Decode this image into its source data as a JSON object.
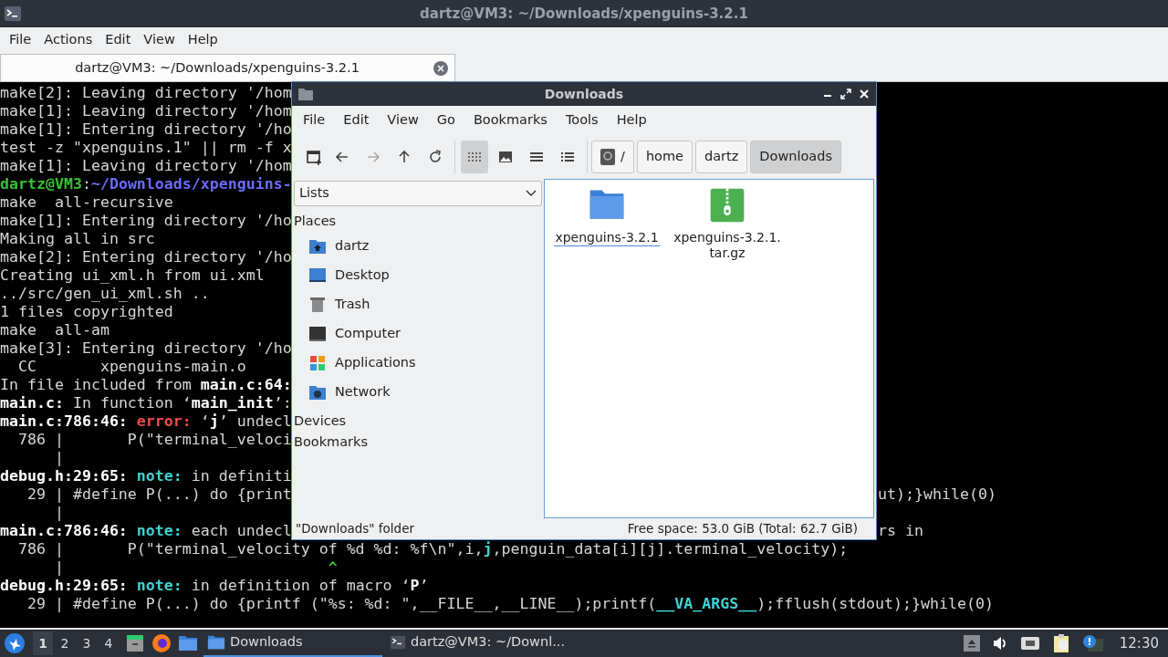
{
  "terminal_window": {
    "title": "dartz@VM3: ~/Downloads/xpenguins-3.2.1",
    "menu": [
      "File",
      "Actions",
      "Edit",
      "View",
      "Help"
    ],
    "tabs": [
      {
        "label": "dartz@VM3: ~/Downloads/xpenguins-3.2.1",
        "selected": true
      }
    ],
    "lines": [
      {
        "left": [
          {
            "t": "make[2]: Leaving directory '/hom"
          }
        ]
      },
      {
        "left": [
          {
            "t": "make[1]: Leaving directory '/hom"
          }
        ]
      },
      {
        "left": [
          {
            "t": "make[1]: Entering directory '/ho"
          }
        ]
      },
      {
        "left": [
          {
            "t": "test -z \"xpenguins.1\" || rm -f x"
          }
        ]
      },
      {
        "left": [
          {
            "t": "make[1]: Leaving directory '/hom"
          }
        ]
      },
      {
        "left": [
          {
            "t": "dartz@VM3",
            "kind": "user"
          },
          {
            "t": ":"
          },
          {
            "t": "~/Downloads/xpenguins-",
            "kind": "path"
          }
        ]
      },
      {
        "left": [
          {
            "t": "make  all-recursive"
          }
        ]
      },
      {
        "left": [
          {
            "t": "make[1]: Entering directory '/ho"
          }
        ]
      },
      {
        "left": [
          {
            "t": "Making all in src"
          }
        ]
      },
      {
        "left": [
          {
            "t": "make[2]: Entering directory '/ho"
          }
        ]
      },
      {
        "left": [
          {
            "t": "Creating ui_xml.h from ui.xml"
          }
        ]
      },
      {
        "left": [
          {
            "t": "../src/gen_ui_xml.sh .."
          }
        ]
      },
      {
        "left": [
          {
            "t": "1 files copyrighted"
          }
        ]
      },
      {
        "left": [
          {
            "t": "make  all-am"
          }
        ]
      },
      {
        "left": [
          {
            "t": "make[3]: Entering directory '/ho"
          }
        ]
      },
      {
        "left": [
          {
            "t": "  CC       xpenguins-main.o"
          }
        ]
      },
      {
        "left": [
          {
            "t": "In file included from "
          },
          {
            "t": "main.c:64:",
            "kind": "bold"
          }
        ]
      },
      {
        "left": [
          {
            "t": "main.c:",
            "kind": "bold"
          },
          {
            "t": " In function ‘"
          },
          {
            "t": "main_init",
            "kind": "bold"
          },
          {
            "t": "’:"
          }
        ]
      },
      {
        "left": [
          {
            "t": "main.c:786:46: ",
            "kind": "bold"
          },
          {
            "t": "error:",
            "kind": "error"
          },
          {
            "t": " ‘"
          },
          {
            "t": "j",
            "kind": "bold"
          },
          {
            "t": "’ undecl"
          }
        ]
      },
      {
        "left": [
          {
            "t": "  786 |       P(\"terminal_veloci"
          }
        ]
      },
      {
        "left": [
          {
            "t": "      |"
          }
        ]
      },
      {
        "left": [
          {
            "t": "debug.h:29:65: ",
            "kind": "bold"
          },
          {
            "t": "note:",
            "kind": "note"
          },
          {
            "t": " in definiti"
          }
        ]
      },
      {
        "left": [
          {
            "t": "   29 | #define P(...) do {print"
          }
        ],
        "right": [
          {
            "t": "ut);}while(0)"
          }
        ]
      },
      {
        "left": [
          {
            "t": "      |"
          }
        ]
      },
      {
        "left": [
          {
            "t": "main.c:786:46: ",
            "kind": "bold"
          },
          {
            "t": "note:",
            "kind": "note"
          },
          {
            "t": " each undecl"
          }
        ],
        "right": [
          {
            "t": "rs in"
          }
        ]
      },
      {
        "left": [
          {
            "t": "  786 |       P(\"terminal_velocity of %d %d: %f\\n\",i,"
          },
          {
            "t": "j",
            "kind": "note"
          },
          {
            "t": ",penguin_data[i][j].terminal_velocity);"
          }
        ]
      },
      {
        "left": [
          {
            "t": "      |                             "
          },
          {
            "t": "^",
            "kind": "caret"
          }
        ]
      },
      {
        "left": [
          {
            "t": "debug.h:29:65: ",
            "kind": "bold"
          },
          {
            "t": "note:",
            "kind": "note"
          },
          {
            "t": " in definition of macro ‘"
          },
          {
            "t": "P",
            "kind": "bold"
          },
          {
            "t": "’"
          }
        ]
      },
      {
        "left": [
          {
            "t": "   29 | #define P(...) do {printf (\"%s: %d: \",__FILE__,__LINE__);printf("
          },
          {
            "t": "__VA_ARGS__",
            "kind": "note"
          },
          {
            "t": ");fflush(stdout);}while(0)"
          }
        ]
      }
    ]
  },
  "file_manager": {
    "title": "Downloads",
    "menu": [
      "File",
      "Edit",
      "View",
      "Go",
      "Bookmarks",
      "Tools",
      "Help"
    ],
    "view_modes": [
      {
        "kind": "icons",
        "selected": true
      },
      {
        "kind": "thumbnails",
        "selected": false
      },
      {
        "kind": "compact",
        "selected": false
      },
      {
        "kind": "details",
        "selected": false
      }
    ],
    "path": [
      {
        "label": "/",
        "kind": "root",
        "selected": false
      },
      {
        "label": "home",
        "kind": "dir",
        "selected": false
      },
      {
        "label": "dartz",
        "kind": "dir",
        "selected": false
      },
      {
        "label": "Downloads",
        "kind": "dir",
        "selected": true
      }
    ],
    "side_pane_mode": "Lists",
    "places_header": "Places",
    "places": [
      {
        "label": "dartz",
        "kind": "home"
      },
      {
        "label": "Desktop",
        "kind": "desktop"
      },
      {
        "label": "Trash",
        "kind": "trash"
      },
      {
        "label": "Computer",
        "kind": "computer"
      },
      {
        "label": "Applications",
        "kind": "apps"
      },
      {
        "label": "Network",
        "kind": "network"
      }
    ],
    "sections": [
      "Devices",
      "Bookmarks"
    ],
    "files": [
      {
        "name": "xpenguins-3.2.1",
        "kind": "folder",
        "focused": true
      },
      {
        "name": "xpenguins-3.2.1.tar.gz",
        "kind": "archive",
        "focused": false
      }
    ],
    "status_left": "\"Downloads\" folder",
    "status_right": "Free space: 53.0 GiB (Total: 62.7 GiB)"
  },
  "taskbar": {
    "workspaces": [
      {
        "label": "1",
        "selected": true
      },
      {
        "label": "2",
        "selected": false
      },
      {
        "label": "3",
        "selected": false
      },
      {
        "label": "4",
        "selected": false
      }
    ],
    "tasks": [
      {
        "label": "Downloads",
        "kind": "folder",
        "selected": true
      },
      {
        "label": "dartz@VM3: ~/Downl...",
        "kind": "terminal",
        "selected": false
      }
    ],
    "clock": "12:30"
  }
}
